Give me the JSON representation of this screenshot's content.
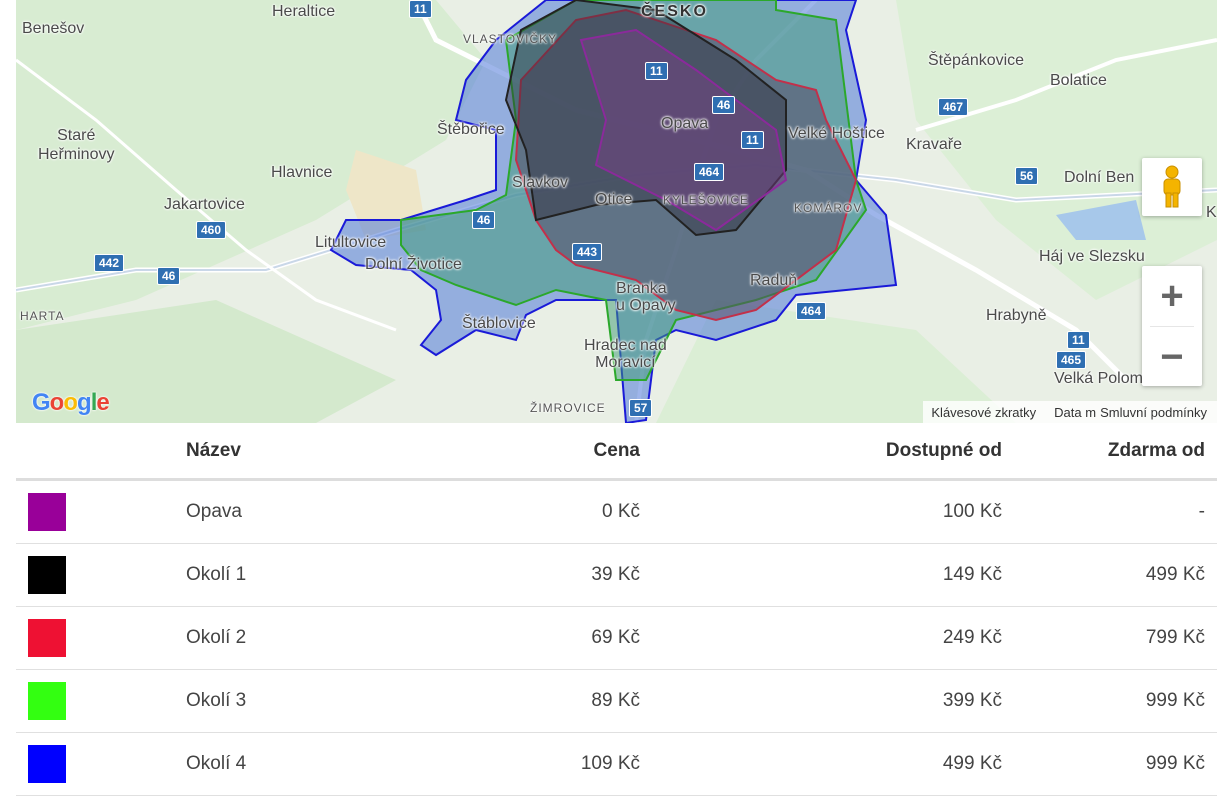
{
  "map": {
    "labels": {
      "heraltice": "Heraltice",
      "benesov": "Benešov",
      "vlastovicky": "VLASTOVIČKY",
      "cesko": "ČESKO",
      "stepankovice": "Štěpánkovice",
      "bolatice": "Bolatice",
      "stare_herminovy": "Staré\nHeřminovy",
      "steborice": "Štěbořice",
      "opava": "Opava",
      "velke_hostice": "Velké Hoštice",
      "kravare": "Kravaře",
      "hlavnice": "Hlavnice",
      "slavkov": "Slavkov",
      "otice": "Otice",
      "kylesovice": "KYLEŠOVICE",
      "komarov": "KOMÁROV",
      "dolni_ben": "Dolní Ben",
      "jakartovice": "Jakartovice",
      "litultovice": "Litultovice",
      "dolni_zivotice": "Dolní Životice",
      "haj_ve_slezsku": "Háj ve Slezsku",
      "raduň": "Raduň",
      "branka_u_opavy": "Branka\nu Opavy",
      "harta": "HARTA",
      "stablovice": "Štáblovice",
      "hrabyne": "Hrabyně",
      "hradec_nad_moravici": "Hradec nad\nMoravicí",
      "velka_polom": "Velká Polom",
      "zimrovice": "ŽIMROVICE",
      "edge_k": "K"
    },
    "shields": {
      "r11_top": "11",
      "r11_a": "11",
      "r46_a": "46",
      "r11_b": "11",
      "r467": "467",
      "r464_a": "464",
      "r56": "56",
      "r46_b": "46",
      "r443": "443",
      "r460": "460",
      "r442": "442",
      "r46_c": "46",
      "r464_b": "464",
      "r11_c": "11",
      "r465": "465",
      "r57": "57"
    },
    "google_logo": "Google",
    "attribution": {
      "shortcuts": "Klávesové zkratky",
      "data": "Data m",
      "terms": "Smluvní podmínky"
    },
    "zoom_in": "+",
    "zoom_out": "−"
  },
  "table": {
    "headers": {
      "name": "Název",
      "price": "Cena",
      "available_from": "Dostupné od",
      "free_from": "Zdarma od"
    },
    "rows": [
      {
        "color": "#990099",
        "name": "Opava",
        "price": "0 Kč",
        "available_from": "100 Kč",
        "free_from": "-"
      },
      {
        "color": "#000000",
        "name": "Okolí 1",
        "price": "39 Kč",
        "available_from": "149 Kč",
        "free_from": "499 Kč"
      },
      {
        "color": "#ee1133",
        "name": "Okolí 2",
        "price": "69 Kč",
        "available_from": "249 Kč",
        "free_from": "799 Kč"
      },
      {
        "color": "#33ff11",
        "name": "Okolí 3",
        "price": "89 Kč",
        "available_from": "399 Kč",
        "free_from": "999 Kč"
      },
      {
        "color": "#0000ff",
        "name": "Okolí 4",
        "price": "109 Kč",
        "available_from": "499 Kč",
        "free_from": "999 Kč"
      }
    ]
  }
}
